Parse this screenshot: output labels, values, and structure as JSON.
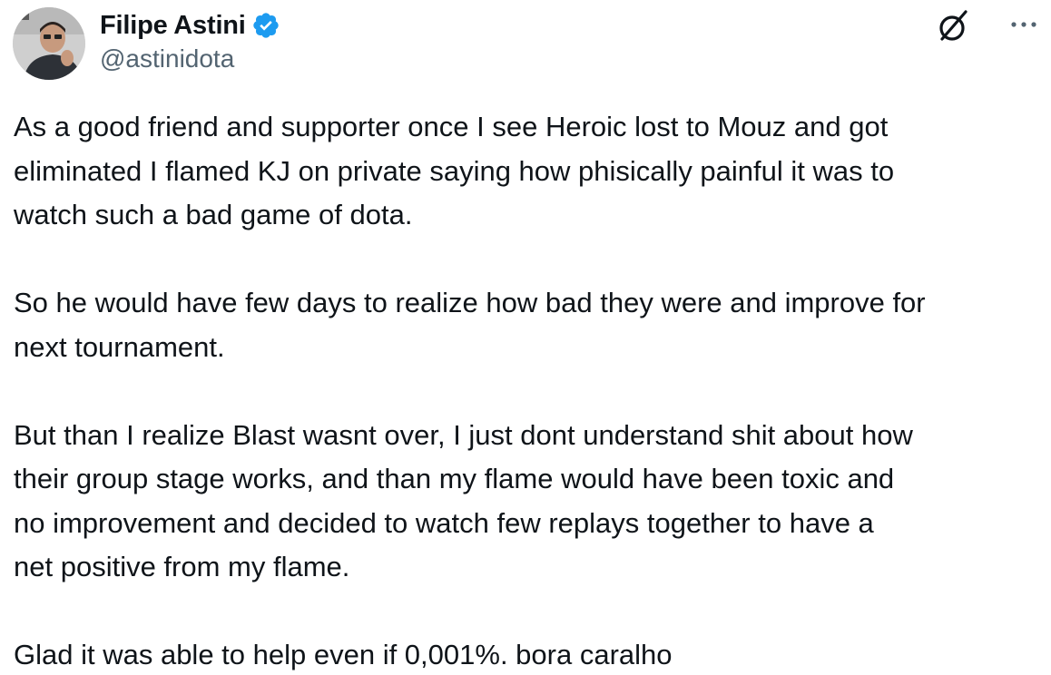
{
  "author": {
    "display_name": "Filipe Astini",
    "handle": "@astinidota",
    "verified": true,
    "avatar_icon": "user-avatar-photo"
  },
  "actions": {
    "grok_icon": "grok-icon",
    "more_icon": "more-options-icon"
  },
  "colors": {
    "verified_blue": "#1d9bf0",
    "handle_gray": "#536471",
    "text": "#0f1419"
  },
  "tweet": {
    "paragraphs": [
      [
        "As a good friend and supporter once I see Heroic lost to Mouz and got",
        "eliminated I flamed KJ on private saying how phisically painful it was to",
        "watch such a bad game of dota."
      ],
      [
        "So he would have few days to realize how bad they were and improve for",
        "next tournament."
      ],
      [
        "But than I realize Blast wasnt over, I just dont understand shit about how",
        "their group stage works, and than my flame would have been toxic and",
        "no improvement and decided to watch few replays together to have a",
        "net positive from my flame."
      ],
      [
        "Glad it was able to help even if 0,001%. bora caralho"
      ]
    ]
  }
}
